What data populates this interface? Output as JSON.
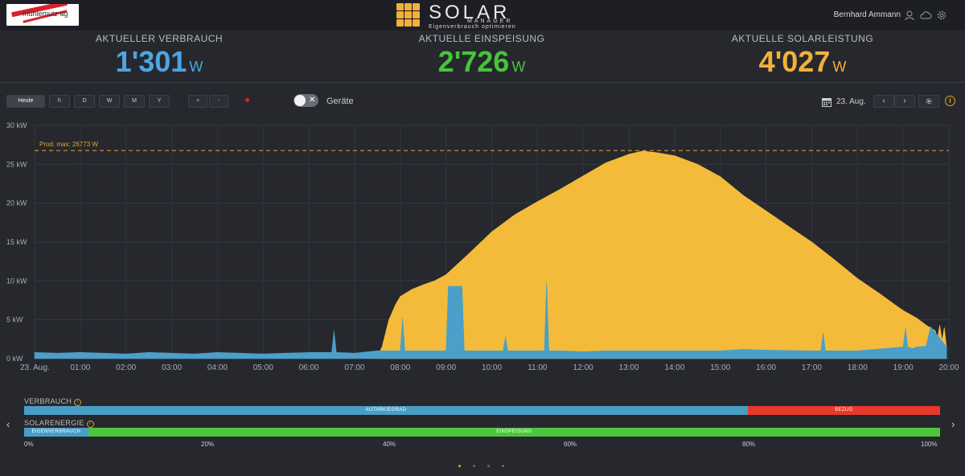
{
  "header": {
    "logo_text": "mühlemutz ag",
    "brand_name": "SOLAR",
    "brand_sub": "MANAGER",
    "brand_tagline": "Eigenverbrauch optimieren",
    "user_name": "Bernhard Ammann",
    "icons": [
      "user-icon",
      "cloud-icon",
      "gear-icon"
    ]
  },
  "kpis": [
    {
      "label": "AKTUELLER VERBRAUCH",
      "value": "1'301",
      "unit": "W",
      "color": "#4da6e0"
    },
    {
      "label": "AKTUELLE EINSPEISUNG",
      "value": "2'726",
      "unit": "W",
      "color": "#48c43a"
    },
    {
      "label": "AKTUELLE SOLARLEISTUNG",
      "value": "4'027",
      "unit": "W",
      "color": "#f3b13a"
    }
  ],
  "controls": {
    "period_buttons": [
      "Heute",
      "h",
      "D",
      "W",
      "M",
      "Y"
    ],
    "zoom_buttons": [
      "+",
      "-"
    ],
    "devices_label": "Geräte",
    "date": "23. Aug.",
    "nav_prev": "‹",
    "nav_next": "›"
  },
  "chart_data": {
    "type": "area",
    "title": "",
    "xlabel": "",
    "ylabel": "",
    "ylim": [
      0,
      30
    ],
    "y_unit": "kW",
    "y_ticks": [
      "0 kW",
      "5 kW",
      "10 kW",
      "15 kW",
      "20 kW",
      "25 kW",
      "30 kW"
    ],
    "x_ticks": [
      "23. Aug.",
      "01:00",
      "02:00",
      "03:00",
      "04:00",
      "05:00",
      "06:00",
      "07:00",
      "08:00",
      "09:00",
      "10:00",
      "11:00",
      "12:00",
      "13:00",
      "14:00",
      "15:00",
      "16:00",
      "17:00",
      "18:00",
      "19:00",
      "20:00"
    ],
    "xlim_hours": [
      0,
      20
    ],
    "annotation": "Prod. max: 26773 W",
    "max_line": 26.773,
    "grid": true,
    "series": [
      {
        "name": "Solarleistung",
        "color": "#f4bb3b",
        "x": [
          7.5,
          7.6,
          7.75,
          7.9,
          8.0,
          8.25,
          8.5,
          8.75,
          9.0,
          9.5,
          10.0,
          10.5,
          11.0,
          11.5,
          12.0,
          12.5,
          13.0,
          13.3,
          13.6,
          14.0,
          14.5,
          15.0,
          15.5,
          16.0,
          16.5,
          17.0,
          17.5,
          18.0,
          18.5,
          18.8,
          19.0,
          19.3,
          19.5,
          19.7,
          19.75,
          19.8,
          19.85,
          19.9,
          19.95
        ],
        "y": [
          0.4,
          1.5,
          5.0,
          7.0,
          8.0,
          8.9,
          9.5,
          10.0,
          10.8,
          13.5,
          16.3,
          18.5,
          20.2,
          21.8,
          23.5,
          25.2,
          26.3,
          26.7,
          26.5,
          26.1,
          25.0,
          23.4,
          21.0,
          19.0,
          17.0,
          15.0,
          12.7,
          10.3,
          8.3,
          7.0,
          6.2,
          5.2,
          4.3,
          3.6,
          2.6,
          4.3,
          2.3,
          4.0,
          1.3
        ]
      },
      {
        "name": "Verbrauch",
        "color": "#4b9fc8",
        "x": [
          0.0,
          0.5,
          1.0,
          1.5,
          2.0,
          2.5,
          3.0,
          3.5,
          4.0,
          4.5,
          5.0,
          5.5,
          6.0,
          6.5,
          6.55,
          6.6,
          7.0,
          7.5,
          8.0,
          8.05,
          8.1,
          8.5,
          9.0,
          9.05,
          9.35,
          9.4,
          10.0,
          10.25,
          10.3,
          10.35,
          10.5,
          11.0,
          11.15,
          11.2,
          11.25,
          11.5,
          12.0,
          12.5,
          13.0,
          14.0,
          15.0,
          15.5,
          16.0,
          17.0,
          17.2,
          17.25,
          17.3,
          18.0,
          19.0,
          19.05,
          19.1,
          19.2,
          19.3,
          19.5,
          19.6,
          19.95
        ],
        "y": [
          0.8,
          0.7,
          0.8,
          0.7,
          0.6,
          0.8,
          0.7,
          0.6,
          0.8,
          0.7,
          0.6,
          0.7,
          0.8,
          0.8,
          3.6,
          0.8,
          0.7,
          1.0,
          1.0,
          5.2,
          1.0,
          1.0,
          1.0,
          9.3,
          9.3,
          1.0,
          1.0,
          1.0,
          2.8,
          1.0,
          1.0,
          1.0,
          1.0,
          9.8,
          1.0,
          1.0,
          0.9,
          1.0,
          1.0,
          1.0,
          1.0,
          1.2,
          1.1,
          1.0,
          1.0,
          3.3,
          1.0,
          1.0,
          1.5,
          3.9,
          1.5,
          1.3,
          1.5,
          1.6,
          4.1,
          1.5
        ]
      }
    ]
  },
  "bars": {
    "verbrauch": {
      "title": "VERBRAUCH",
      "segments": [
        {
          "label": "AUTARKIEGRAD",
          "percent": 79,
          "color": "#4a9ec6"
        },
        {
          "label": "BEZUG",
          "percent": 21,
          "color": "#e8392b"
        }
      ]
    },
    "solarenergie": {
      "title": "SOLARENERGIE",
      "segments": [
        {
          "label": "EIGENVERBRAUCH",
          "percent": 7,
          "color": "#4a9ec6"
        },
        {
          "label": "EINSPEISUNG",
          "percent": 93,
          "color": "#4cc63c"
        }
      ]
    },
    "scale": [
      "0%",
      "20%",
      "40%",
      "60%",
      "80%",
      "100%"
    ]
  },
  "pager": {
    "count": 4,
    "active": 0
  }
}
